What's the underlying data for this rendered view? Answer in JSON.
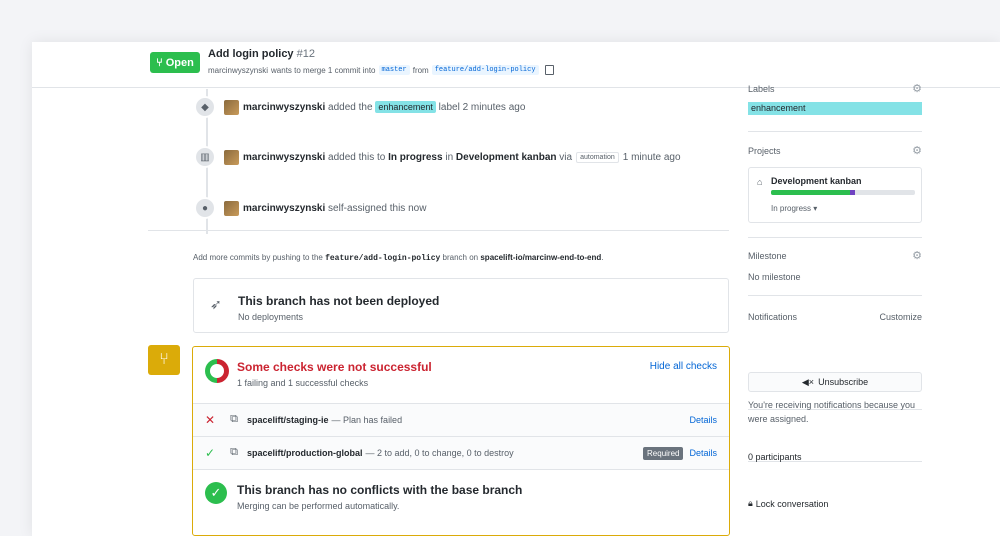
{
  "header": {
    "status": "Open",
    "title": "Add login policy",
    "number": "#12",
    "author": "marcinwyszynski",
    "merge_text": "wants to merge 1 commit into",
    "base": "master",
    "from_text": "from",
    "head": "feature/add-login-policy"
  },
  "timeline": [
    {
      "user": "marcinwyszynski",
      "pre": "added the",
      "label": "enhancement",
      "post": "label 2 minutes ago"
    },
    {
      "user": "marcinwyszynski",
      "pre": "added this to",
      "col": "In progress",
      "in": "in",
      "board": "Development kanban",
      "via": "via",
      "app": "automation",
      "time": "1 minute ago"
    },
    {
      "user": "marcinwyszynski",
      "pre": "self-assigned this now"
    }
  ],
  "hint": {
    "pre": "Add more commits by pushing to the",
    "branch": "feature/add-login-policy",
    "mid": "branch on",
    "repo": "spacelift-io/marcinw-end-to-end",
    "end": "."
  },
  "deploy": {
    "title": "This branch has not been deployed",
    "sub": "No deployments"
  },
  "checks": {
    "title": "Some checks were not successful",
    "sub": "1 failing and 1 successful checks",
    "hide": "Hide all checks",
    "rows": [
      {
        "name": "spacelift/staging-ie",
        "desc": "— Plan has failed",
        "details": "Details",
        "status": "fail"
      },
      {
        "name": "spacelift/production-global",
        "desc": "— 2 to add, 0 to change, 0 to destroy",
        "required": "Required",
        "details": "Details",
        "status": "success"
      }
    ]
  },
  "conflicts": {
    "title": "This branch has no conflicts with the base branch",
    "sub": "Merging can be performed automatically."
  },
  "sidebar": {
    "labels_h": "Labels",
    "label": "enhancement",
    "projects_h": "Projects",
    "project": "Development kanban",
    "project_status": "In progress ▾",
    "project_done": 0.55,
    "project_in_progress": 0.03,
    "milestone_h": "Milestone",
    "milestone": "No milestone",
    "notif_h": "Notifications",
    "customize": "Customize",
    "unsubscribe": "Unsubscribe",
    "notif_text": "You're receiving notifications because you were assigned.",
    "participants": "0 participants",
    "lock": "Lock conversation"
  },
  "colors": {
    "open": "#2cbe4e",
    "fail": "#cb2431",
    "label": "#84e2e6",
    "link": "#0366d6",
    "warning": "#dbab09"
  }
}
